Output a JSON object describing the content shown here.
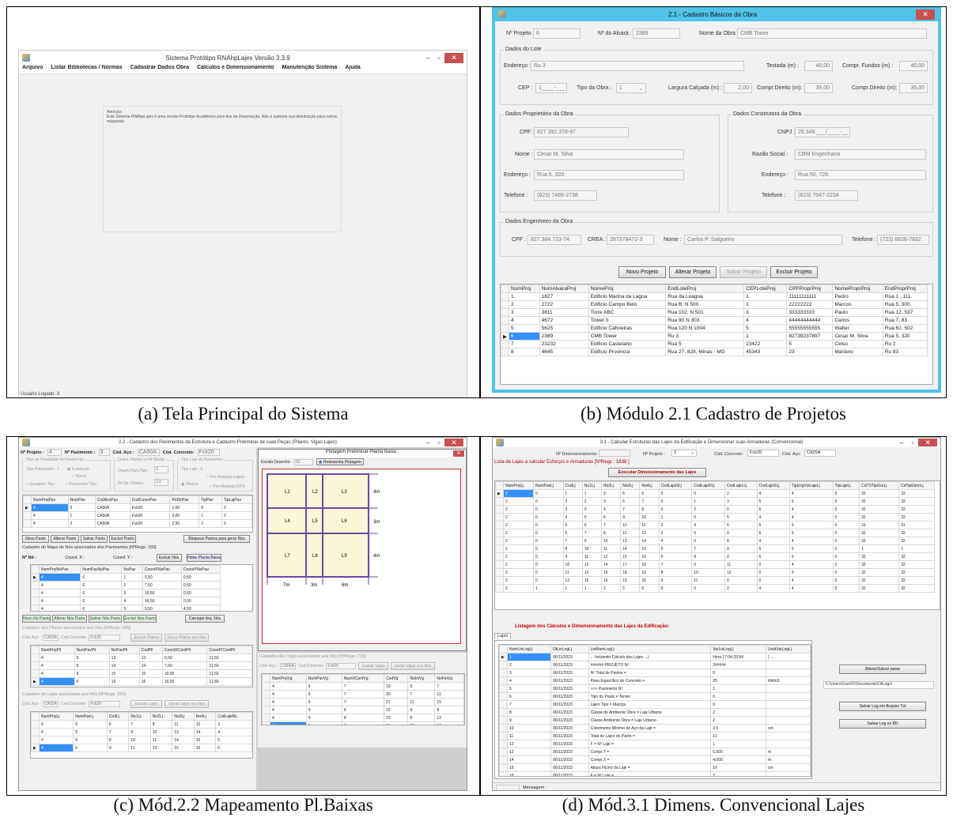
{
  "captions": {
    "a": "(a) Tela Principal do Sistema",
    "b": "(b) Módulo 2.1 Cadastro de Projetos",
    "c": "(c) Mód.2.2 Mapeamento Pl.Baixas",
    "d": "(d) Mód.3.1 Dimens. Convencional Lajes"
  },
  "a": {
    "title": "Sistema Protótipo RNAhpLajes Versão 3.3.9",
    "menu": [
      "Arquivo",
      "Listar Bibliotecas / Normas",
      "Cadastrar Dados Obra",
      "Cálculos e Dimensionamento",
      "Manutenção Sistema",
      "Ajuda"
    ],
    "notice_title": "Atenção:",
    "notice_text": "Este Sistema RNAhpLajes é uma versão Protótipo Acadêmico para fins de Dissertação. Não é autoriza sua distribuição para outras máquinas.",
    "status": "Usuário Logado: 3"
  },
  "b": {
    "title": "2.1 - Cadastro Básicos da Obra",
    "top": {
      "nproj_l": "Nº Projeto :",
      "nproj_v": "6",
      "alvara_l": "Nº do Alvará :",
      "alvara_v": "2389",
      "nome_l": "Nome da Obra :",
      "nome_v": "CMB Tower"
    },
    "lote": {
      "title": "Dados do Lote",
      "end_l": "Endereço :",
      "end_v": "Ru 3",
      "testada_l": "Testada (m) :",
      "testada_v": "40,00",
      "cf_l": "Compr. Fundos (m) :",
      "cf_v": "40,00",
      "cep_l": "CEP :",
      "cep_v": "1____-___",
      "tipo_l": "Tipo da Obra :",
      "tipo_v": "1",
      "larg_l": "Largura Calçada (m) :",
      "larg_v": "2,00",
      "cd_l": "Compr.Direito (m):",
      "cd_v": "35,00",
      "ce_l": "Compr.Direito (m):",
      "ce_v": "35,00"
    },
    "prop": {
      "title": "Dados Proprietário da Obra",
      "cpf_l": "CPF :",
      "cpf_v": "827.392.378-97",
      "nome_l": "Nome :",
      "nome_v": "Cesar M. Silva",
      "end_l": "Endereço :",
      "end_v": "Rua 5, 320",
      "tel_l": "Telefone :",
      "tel_v": "(823) 7489-2738"
    },
    "const": {
      "title": "Dados Construtora da Obra",
      "cnpj_l": "CNPJ :",
      "cnpj_v": "29.349.___/____-__",
      "rs_l": "Razão Social :",
      "rs_v": "CBM Engenharia",
      "end_l": "Endereço :",
      "end_v": "Rua 50, 726",
      "tel_l": "Telefone :",
      "tel_v": "(823) 7947-2234"
    },
    "eng": {
      "title": "Dados Engenheiro da Obra",
      "cpf_l": "CPF :",
      "cpf_v": "827.384.723-74",
      "crea_l": "CREA :",
      "crea_v": "287378472-3",
      "nome_l": "Nome :",
      "nome_v": "Carlos P. Salgueiro",
      "tel_l": "Telefone :",
      "tel_v": "(723) 6826-7832"
    },
    "buttons": [
      "Novo Projeto",
      "Alterar Projeto",
      "Salvar Projeto",
      "Excluir Projeto"
    ],
    "grid": {
      "cols": [
        "NumProj",
        "NumAlvaraProj",
        "NomeProj",
        "EndLoteProj",
        "CEPLoteProj",
        "CPFProprProj",
        "NomeProprProj",
        "EndProprProj"
      ],
      "rows": [
        [
          "1",
          "1827",
          "Edificio Marina da Lagoa",
          "Rua da Loagoa",
          "1",
          "11111111111",
          "Pedro",
          "Rua 1 , 111"
        ],
        [
          "2",
          "2722",
          "Edificio Campo Belo",
          "Rua B, N 500",
          "1",
          "22222222",
          "Marcos",
          "Rua 5, 300"
        ],
        [
          "3",
          "3811",
          "Torre ABC",
          "Rua 102, N 501",
          "3",
          "333333333",
          "Paulo",
          "Rua 12, 537"
        ],
        [
          "4",
          "4672",
          "Tower II",
          "Rua 90 N 303",
          "4",
          "44444444444",
          "Carlos",
          "Rua 7, 83"
        ],
        [
          "5",
          "5625",
          "Edificio Cahoeiras",
          "Rua 120 N 1004",
          "5",
          "55555555555",
          "Walter",
          "Rua 62, 502"
        ],
        [
          "6",
          "2389",
          "CMB Tower",
          "Ru 3",
          "1",
          "82739237897",
          "Cesar M. Silva",
          "Rua 5, 320"
        ],
        [
          "7",
          "23232",
          "Edificio Castelano",
          "Rua 5",
          "23422",
          "5",
          "Celso",
          "Ru 2"
        ],
        [
          "8",
          "4645",
          "Edificio Provincia",
          "Rua 27, 828, Minas - MG",
          "45343",
          "23",
          "Mariano",
          "Ru 83"
        ]
      ]
    }
  },
  "c": {
    "title": "2.2 - Cadastro dos Pavimentos da Estrutura e Cadastro Preliminar de suas Peças (Pilares, Vigas Lajes)",
    "topbar": [
      "Nº Projeto :",
      "4",
      "Nº Pavimento :",
      "3",
      "Cód. Aço :",
      "CA50A",
      "Cód. Concreto:",
      "Fck20"
    ],
    "grp1": [
      "Tipo de Finalidade do Pavimento",
      "Quant. Pavtos e Pé Direito",
      "Tipo Laje do Pavimento"
    ],
    "opts": [
      "Tipo Pavimento : 1",
      "Fundacao",
      "Terreo",
      "Garagem Tipo",
      "Pavimento Tipo",
      "Quant.Pavs.Tipo:",
      "1",
      "Pé Dir. Pavtos:",
      "1,0",
      "Tipo Laje : 0",
      "Pré-Moldada Lajota",
      "Maciça",
      "Pré-Moldada EPS"
    ],
    "pav": {
      "cols": [
        "NumProjPav",
        "NumPav",
        "CodAcoPav",
        "CodConcrPav",
        "PeDirPav",
        "TipPav",
        "TipLajPav"
      ],
      "rows": [
        [
          "4",
          "0",
          "CA50A",
          "Fck20",
          "1,00",
          "0",
          "0"
        ],
        [
          "4",
          "1",
          "CA50A",
          "Fck20",
          "3,00",
          "1",
          "0"
        ],
        [
          "4",
          "2",
          "CA50A",
          "Fck20",
          "2,50",
          "2",
          "0"
        ]
      ]
    },
    "pavbtns": [
      "Novo Pavto",
      "Alterar Pavto",
      "Salvar Pavto",
      "Excluir Pavto",
      "Bloquear Pavtos para gerar Nós"
    ],
    "nos_title": "Cadastro do Mapa de Nós associados dos Pavimentos [NºRegs: 160]",
    "nos_fields": [
      "Nº Nó :",
      "Coord. X :",
      "Coord. Y :",
      "Excluir Nós",
      "Plotar Planta Baixa"
    ],
    "nos": {
      "cols": [
        "NumProjNoPav",
        "NumPavNoPav",
        "NoPav",
        "CoordXNoPav",
        "CoordYNoPav"
      ],
      "rows": [
        [
          "4",
          "0",
          "1",
          "0,50",
          "0,50"
        ],
        [
          "4",
          "0",
          "2",
          "7,50",
          "0,50"
        ],
        [
          "4",
          "0",
          "3",
          "10,50",
          "0,50"
        ],
        [
          "4",
          "0",
          "4",
          "16,50",
          "0,50"
        ],
        [
          "4",
          "0",
          "5",
          "0,50",
          "4,50"
        ]
      ]
    },
    "nosbtns": [
      "Novo Nó Pavto",
      "Alterar Nós Pavto",
      "Salvar Nós Pavto",
      "Excluir Nós Pavto",
      "Carregar Arq. Nós"
    ],
    "pil_title": "Cadastro dos Pilares associados aos Nós [NºRegs: 505]",
    "pil_fields": [
      "Cód. Aço :",
      "CA50A",
      "Cod.Concreto:",
      "Fck20",
      "Excluir Pilares",
      "Gerar Pilares nos Nós"
    ],
    "pil": {
      "cols": [
        "NumProjPil",
        "NumPavPil",
        "NoPavPil",
        "CodPil",
        "CoordXCentPil",
        "CoordYCentPil"
      ],
      "rows": [
        [
          "4",
          "9",
          "13",
          "13",
          "0,50",
          "11,50"
        ],
        [
          "4",
          "9",
          "14",
          "14",
          "7,50",
          "11,50"
        ],
        [
          "4",
          "9",
          "15",
          "15",
          "10,50",
          "11,50"
        ],
        [
          "4",
          "9",
          "16",
          "16",
          "16,50",
          "11,50"
        ]
      ]
    },
    "laj_title": "Cadastro de Lajes associadas aos Nós [NºRegs: 250]",
    "laj_fields": [
      "Cód. Aço :",
      "CA50A",
      "Cod.Concreto:",
      "Fck20",
      "Excluir Lajes",
      "Gerar Lajes nos Nós"
    ],
    "laj": {
      "cols": [
        "NumProjLj",
        "NumPavLj",
        "CodLj",
        "No1Lj",
        "No2Lj",
        "No3Lj",
        "No4Lj",
        "CodLajeNL"
      ],
      "rows": [
        [
          "4",
          "9",
          "6",
          "7",
          "8",
          "11",
          "12",
          "3"
        ],
        [
          "4",
          "9",
          "7",
          "9",
          "10",
          "13",
          "14",
          "4"
        ],
        [
          "4",
          "9",
          "8",
          "10",
          "11",
          "14",
          "15",
          "5"
        ],
        [
          "4",
          "9",
          "9",
          "11",
          "12",
          "15",
          "16",
          "6"
        ]
      ]
    },
    "plot": {
      "title": "Plotagem Preliminar Planta Baixa :",
      "escala_l": "Escala Desenho:",
      "escala_v": "50",
      "redesenha": "Redesenha Plotagem",
      "slabs": [
        "L1",
        "L2",
        "L3",
        "L4",
        "L5",
        "L6",
        "L7",
        "L8",
        "L9"
      ],
      "dims_r": [
        "4m",
        "3m",
        "4m"
      ],
      "dims_b": [
        "7m",
        "3m",
        "6m"
      ]
    },
    "vig_title": "Cadastro das Vigas associadas aos Nós [NºRegs: 719]",
    "vig_fields": [
      "Cód. Aço :",
      "CA50A",
      "Cod.Concreto:",
      "Fck20",
      "Excluir Vigas",
      "Gerar Vigas nos Nós"
    ],
    "vig": {
      "cols": [
        "NumProjVg",
        "NumPavVg",
        "NumVConfVg",
        "CodVg",
        "NoIniVg",
        "NoFinVg"
      ],
      "rows": [
        [
          "4",
          "9",
          "7",
          "19",
          "3",
          "7"
        ],
        [
          "4",
          "9",
          "7",
          "20",
          "7",
          "11"
        ],
        [
          "4",
          "9",
          "7",
          "21",
          "11",
          "15"
        ],
        [
          "4",
          "9",
          "8",
          "22",
          "4",
          "8"
        ],
        [
          "4",
          "9",
          "8",
          "23",
          "8",
          "12"
        ],
        [
          "4",
          "9",
          "8",
          "24",
          "12",
          "16"
        ]
      ]
    }
  },
  "d": {
    "title": "3.1 - Calcular Estruturas das Lajes da Edificação e Dimensionar suas Armaduras (Convencional)",
    "top": [
      "Nº Dimensionamento :",
      "Nº Projeto :",
      "2",
      "Cód. Concreto:",
      "Fck20",
      "Cód. Aço:",
      "CA25A"
    ],
    "list_title": "Lista de Lajes a calcular Esforços e Armaduras [NºRegs : 1838 ]",
    "exec_btn": "Executar Dimensionamento das Lajes",
    "lj": {
      "cols": [
        "NumProjLj",
        "NumPavLj",
        "CodLj",
        "No1Lj",
        "No2Lj",
        "No3Lj",
        "No4Lj",
        "CodLajeNLj",
        "CodLajeDLj",
        "CodLajeLLj",
        "CodLajeSLj",
        "TipEngVizLajeLj",
        "TipLajeLj",
        "CdTSTipUsoLj",
        "CdTipElemLj"
      ],
      "rows": [
        [
          "2",
          "0",
          "1",
          "1",
          "2",
          "5",
          "6",
          "0",
          "0",
          "2",
          "4",
          "4",
          "0",
          "32",
          "32"
        ],
        [
          "2",
          "0",
          "2",
          "2",
          "3",
          "6",
          "7",
          "0",
          "1",
          "3",
          "5",
          "6",
          "0",
          "32",
          "32"
        ],
        [
          "2",
          "0",
          "3",
          "3",
          "4",
          "7",
          "8",
          "0",
          "2",
          "0",
          "6",
          "4",
          "0",
          "32",
          "32"
        ],
        [
          "2",
          "0",
          "4",
          "5",
          "6",
          "9",
          "10",
          "1",
          "0",
          "5",
          "4",
          "4",
          "0",
          "32",
          "32"
        ],
        [
          "2",
          "0",
          "5",
          "6",
          "7",
          "10",
          "11",
          "2",
          "4",
          "6",
          "5",
          "5",
          "0",
          "31",
          "31"
        ],
        [
          "2",
          "0",
          "6",
          "7",
          "8",
          "11",
          "12",
          "3",
          "5",
          "0",
          "6",
          "6",
          "0",
          "32",
          "32"
        ],
        [
          "2",
          "0",
          "7",
          "9",
          "10",
          "13",
          "14",
          "4",
          "0",
          "8",
          "4",
          "4",
          "0",
          "32",
          "32"
        ],
        [
          "2",
          "0",
          "8",
          "10",
          "11",
          "14",
          "15",
          "5",
          "7",
          "9",
          "5",
          "5",
          "0",
          "1",
          "1"
        ],
        [
          "2",
          "0",
          "9",
          "11",
          "12",
          "15",
          "16",
          "6",
          "8",
          "0",
          "6",
          "6",
          "0",
          "32",
          "32"
        ],
        [
          "2",
          "0",
          "10",
          "13",
          "14",
          "17",
          "18",
          "7",
          "0",
          "11",
          "0",
          "4",
          "0",
          "32",
          "32"
        ],
        [
          "2",
          "0",
          "11",
          "14",
          "15",
          "18",
          "19",
          "8",
          "10",
          "12",
          "0",
          "5",
          "0",
          "32",
          "32"
        ],
        [
          "2",
          "0",
          "12",
          "15",
          "16",
          "19",
          "20",
          "9",
          "11",
          "0",
          "0",
          "4",
          "0",
          "32",
          "32"
        ],
        [
          "2",
          "1",
          "1",
          "1",
          "2",
          "5",
          "6",
          "0",
          "0",
          "2",
          "4",
          "4",
          "0",
          "32",
          "32"
        ]
      ]
    },
    "log_title": "Listagem dos Cálculos e Dimensionamento das Lajes da Edificação:",
    "tab": "Lajes",
    "log": {
      "cols": [
        "NumLinLogLj",
        "DtLinLogLj",
        "LinMemLogLj",
        "VarLinLogLj",
        "UnidVarLogLj"
      ],
      "rows": [
        [
          "1",
          "06/11/2023",
          "... Iniciando Cálculo das Lajes ...}",
          "Hora 17:04:33:94",
          "} ..."
        ],
        [
          "2",
          "06/11/2023",
          "###### PROJETO Nº:",
          "2#####",
          ""
        ],
        [
          "3",
          "06/11/2023",
          "Nº Total de Pavtos =",
          "0",
          ""
        ],
        [
          "4",
          "06/11/2023",
          "Peso Específico do Concreto =",
          "25",
          "kN/m3"
        ],
        [
          "5",
          "06/11/2023",
          ">>> Pavimento Nº:",
          "1",
          ""
        ],
        [
          "6",
          "06/11/2023",
          "Tipo do Pavto = Terreo",
          "0",
          ""
        ],
        [
          "7",
          "06/11/2023",
          "Lajes Tipo = Maciça·",
          "0",
          ""
        ],
        [
          "8",
          "06/11/2023",
          "Classe do Ambiente Obra = Laje Urbano·",
          "2",
          ""
        ],
        [
          "9",
          "06/11/2023",
          "Classe Ambiente Obra = Laje Urbano·",
          "2",
          ""
        ],
        [
          "10",
          "06/11/2023",
          "Cobrimento Mínimo do Aço da Laje =",
          "2,5",
          "cm"
        ],
        [
          "11",
          "06/11/2023",
          "Total de Lajes do Pavto =",
          "12",
          ""
        ],
        [
          "12",
          "06/11/2023",
          "F = Nº Laje =",
          "1",
          ""
        ],
        [
          "13",
          "06/11/2023",
          "Compr.Y =",
          "5,500",
          "m"
        ],
        [
          "14",
          "06/11/2023",
          "Compr.X =",
          "4,000",
          "m"
        ],
        [
          "15",
          "06/11/2023",
          "Altura H(cm) da Laje =",
          "10",
          "cm"
        ],
        [
          "16",
          "06/11/2023",
          "F = Nº Laje =",
          "2",
          ""
        ],
        [
          "17",
          "06/11/2023",
          "Compr.Y =",
          "3,000",
          "m"
        ]
      ]
    },
    "side": {
      "alt": "Alterar/Salvar pasta",
      "path": "C:\\Users\\User01\\Documents\\CALogs\\",
      "txt": "Salvar Log em Arquivo Txt",
      "bd": "Salvar Log no BD"
    },
    "msg": "Mensagem :"
  }
}
